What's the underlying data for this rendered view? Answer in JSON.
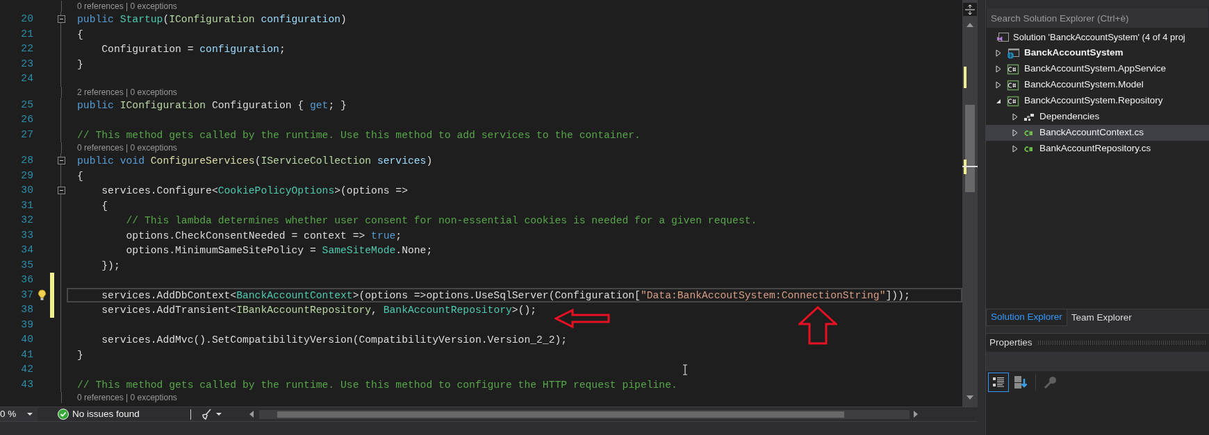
{
  "editor": {
    "lines": [
      {
        "kind": "codelens",
        "text": "0 references | 0 exceptions"
      },
      {
        "kind": "code",
        "number": "20",
        "fold": true,
        "changed": false,
        "current": false,
        "bulb": false,
        "tokens": [
          {
            "text": "public ",
            "kind": "keyword"
          },
          {
            "text": "Startup",
            "kind": "type"
          },
          {
            "text": "(",
            "kind": "plain"
          },
          {
            "text": "IConfiguration",
            "kind": "iface"
          },
          {
            "text": " configuration",
            "kind": "param"
          },
          {
            "text": ")",
            "kind": "plain"
          }
        ]
      },
      {
        "kind": "code",
        "number": "21",
        "fold": false,
        "changed": false,
        "current": false,
        "bulb": false,
        "tokens": [
          {
            "text": "{",
            "kind": "plain"
          }
        ]
      },
      {
        "kind": "code",
        "number": "22",
        "fold": false,
        "changed": false,
        "current": false,
        "bulb": false,
        "tokens": [
          {
            "text": "    Configuration = ",
            "kind": "plain"
          },
          {
            "text": "configuration",
            "kind": "param"
          },
          {
            "text": ";",
            "kind": "plain"
          }
        ]
      },
      {
        "kind": "code",
        "number": "23",
        "fold": false,
        "changed": false,
        "current": false,
        "bulb": false,
        "tokens": [
          {
            "text": "}",
            "kind": "plain"
          }
        ]
      },
      {
        "kind": "code",
        "number": "24",
        "fold": false,
        "changed": false,
        "current": false,
        "bulb": false
      },
      {
        "kind": "codelens",
        "text": "2 references | 0 exceptions"
      },
      {
        "kind": "code",
        "number": "25",
        "fold": false,
        "changed": false,
        "current": false,
        "bulb": false,
        "tokens": [
          {
            "text": "public ",
            "kind": "keyword"
          },
          {
            "text": "IConfiguration",
            "kind": "iface"
          },
          {
            "text": " Configuration { ",
            "kind": "plain"
          },
          {
            "text": "get",
            "kind": "keyword"
          },
          {
            "text": "; }",
            "kind": "plain"
          }
        ]
      },
      {
        "kind": "code",
        "number": "26",
        "fold": false,
        "changed": false,
        "current": false,
        "bulb": false
      },
      {
        "kind": "code",
        "number": "27",
        "fold": false,
        "changed": false,
        "current": false,
        "bulb": false,
        "tokens": [
          {
            "text": "// This method gets called by the runtime. Use this method to add services to the container.",
            "kind": "comment"
          }
        ]
      },
      {
        "kind": "codelens",
        "text": "0 references | 0 exceptions"
      },
      {
        "kind": "code",
        "number": "28",
        "fold": true,
        "changed": false,
        "current": false,
        "bulb": false,
        "tokens": [
          {
            "text": "public ",
            "kind": "keyword"
          },
          {
            "text": "void ",
            "kind": "keyword"
          },
          {
            "text": "ConfigureServices",
            "kind": "method"
          },
          {
            "text": "(",
            "kind": "plain"
          },
          {
            "text": "IServiceCollection",
            "kind": "iface"
          },
          {
            "text": " services",
            "kind": "param"
          },
          {
            "text": ")",
            "kind": "plain"
          }
        ]
      },
      {
        "kind": "code",
        "number": "29",
        "fold": false,
        "changed": false,
        "current": false,
        "bulb": false,
        "tokens": [
          {
            "text": "{",
            "kind": "plain"
          }
        ]
      },
      {
        "kind": "code",
        "number": "30",
        "fold": true,
        "changed": false,
        "current": false,
        "bulb": false,
        "tokens": [
          {
            "text": "    services.Configure<",
            "kind": "plain"
          },
          {
            "text": "CookiePolicyOptions",
            "kind": "type"
          },
          {
            "text": ">(options =>",
            "kind": "plain"
          }
        ]
      },
      {
        "kind": "code",
        "number": "31",
        "fold": false,
        "changed": false,
        "current": false,
        "bulb": false,
        "tokens": [
          {
            "text": "    {",
            "kind": "plain"
          }
        ]
      },
      {
        "kind": "code",
        "number": "32",
        "fold": false,
        "changed": false,
        "current": false,
        "bulb": false,
        "tokens": [
          {
            "text": "        // This lambda determines whether user consent for non-essential cookies is needed for a given request.",
            "kind": "comment"
          }
        ]
      },
      {
        "kind": "code",
        "number": "33",
        "fold": false,
        "changed": false,
        "current": false,
        "bulb": false,
        "tokens": [
          {
            "text": "        options.CheckConsentNeeded = context => ",
            "kind": "plain"
          },
          {
            "text": "true",
            "kind": "keyword"
          },
          {
            "text": ";",
            "kind": "plain"
          }
        ]
      },
      {
        "kind": "code",
        "number": "34",
        "fold": false,
        "changed": false,
        "current": false,
        "bulb": false,
        "tokens": [
          {
            "text": "        options.MinimumSameSitePolicy = ",
            "kind": "plain"
          },
          {
            "text": "SameSiteMode",
            "kind": "type"
          },
          {
            "text": ".None;",
            "kind": "plain"
          }
        ]
      },
      {
        "kind": "code",
        "number": "35",
        "fold": false,
        "changed": false,
        "current": false,
        "bulb": false,
        "tokens": [
          {
            "text": "    });",
            "kind": "plain"
          }
        ]
      },
      {
        "kind": "code",
        "number": "36",
        "fold": false,
        "changed": true,
        "current": false,
        "bulb": false
      },
      {
        "kind": "code",
        "number": "37",
        "fold": false,
        "changed": true,
        "current": true,
        "bulb": true,
        "tokens": [
          {
            "text": "    services.AddDbContext<",
            "kind": "plain"
          },
          {
            "text": "BanckAccountContext",
            "kind": "type"
          },
          {
            "text": ">(options =>options.UseSqlServer(Configuration[",
            "kind": "plain"
          },
          {
            "text": "\"Data:BankAccoutSystem:ConnectionString\"",
            "kind": "string"
          },
          {
            "text": "]));",
            "kind": "plain"
          }
        ]
      },
      {
        "kind": "code",
        "number": "38",
        "fold": false,
        "changed": true,
        "current": false,
        "bulb": false,
        "tokens": [
          {
            "text": "    services.AddTransient<",
            "kind": "plain"
          },
          {
            "text": "IBankAccountRepository",
            "kind": "iface"
          },
          {
            "text": ", ",
            "kind": "plain"
          },
          {
            "text": "BankAccountRepository",
            "kind": "type"
          },
          {
            "text": ">();",
            "kind": "plain"
          }
        ]
      },
      {
        "kind": "code",
        "number": "39",
        "fold": false,
        "changed": false,
        "current": false,
        "bulb": false
      },
      {
        "kind": "code",
        "number": "40",
        "fold": false,
        "changed": false,
        "current": false,
        "bulb": false,
        "tokens": [
          {
            "text": "    services.AddMvc().SetCompatibilityVersion(CompatibilityVersion.Version_2_2);",
            "kind": "plain"
          }
        ]
      },
      {
        "kind": "code",
        "number": "41",
        "fold": false,
        "changed": false,
        "current": false,
        "bulb": false,
        "tokens": [
          {
            "text": "}",
            "kind": "plain"
          }
        ]
      },
      {
        "kind": "code",
        "number": "42",
        "fold": false,
        "changed": false,
        "current": false,
        "bulb": false
      },
      {
        "kind": "code",
        "number": "43",
        "fold": false,
        "changed": false,
        "current": false,
        "bulb": false,
        "tokens": [
          {
            "text": "// This method gets called by the runtime. Use this method to configure the HTTP request pipeline.",
            "kind": "comment"
          }
        ]
      },
      {
        "kind": "codelens",
        "text": "0 references | 0 exceptions"
      }
    ]
  },
  "status_bar": {
    "zoom": "0 %",
    "issues": "No issues found"
  },
  "solution_explorer": {
    "search": {
      "placeholder": "Search Solution Explorer (Ctrl+è)"
    },
    "tree": {
      "label": "Solution 'BanckAccountSystem' (4 of 4 proj",
      "children": [
        {
          "label": "BanckAccountSystem",
          "kind": "web",
          "startup": true,
          "expanded": false,
          "selected": false
        },
        {
          "label": "BanckAccountSystem.AppService",
          "kind": "project",
          "startup": false,
          "expanded": false,
          "selected": false
        },
        {
          "label": "BanckAccountSystem.Model",
          "kind": "project",
          "startup": false,
          "expanded": false,
          "selected": false
        },
        {
          "label": "BanckAccountSystem.Repository",
          "kind": "project",
          "startup": false,
          "expanded": true,
          "selected": false,
          "children": [
            {
              "label": "Dependencies",
              "kind": "dependencies",
              "startup": false,
              "expanded": false,
              "selected": false
            },
            {
              "label": "BanckAccountContext.cs",
              "kind": "file",
              "startup": false,
              "expanded": false,
              "selected": true
            },
            {
              "label": "BankAccountRepository.cs",
              "kind": "file",
              "startup": false,
              "expanded": false,
              "selected": false
            }
          ]
        }
      ]
    }
  },
  "tabs": [
    {
      "label": "Solution Explorer",
      "selected": true
    },
    {
      "label": "Team Explorer",
      "selected": false
    }
  ],
  "properties": {
    "title": "Properties",
    "tools": [
      {
        "kind": "categorized",
        "selected": true,
        "disabled": false
      },
      {
        "kind": "alphabetical",
        "selected": false,
        "disabled": false
      },
      {
        "kind": "key",
        "selected": false,
        "disabled": true
      }
    ]
  }
}
